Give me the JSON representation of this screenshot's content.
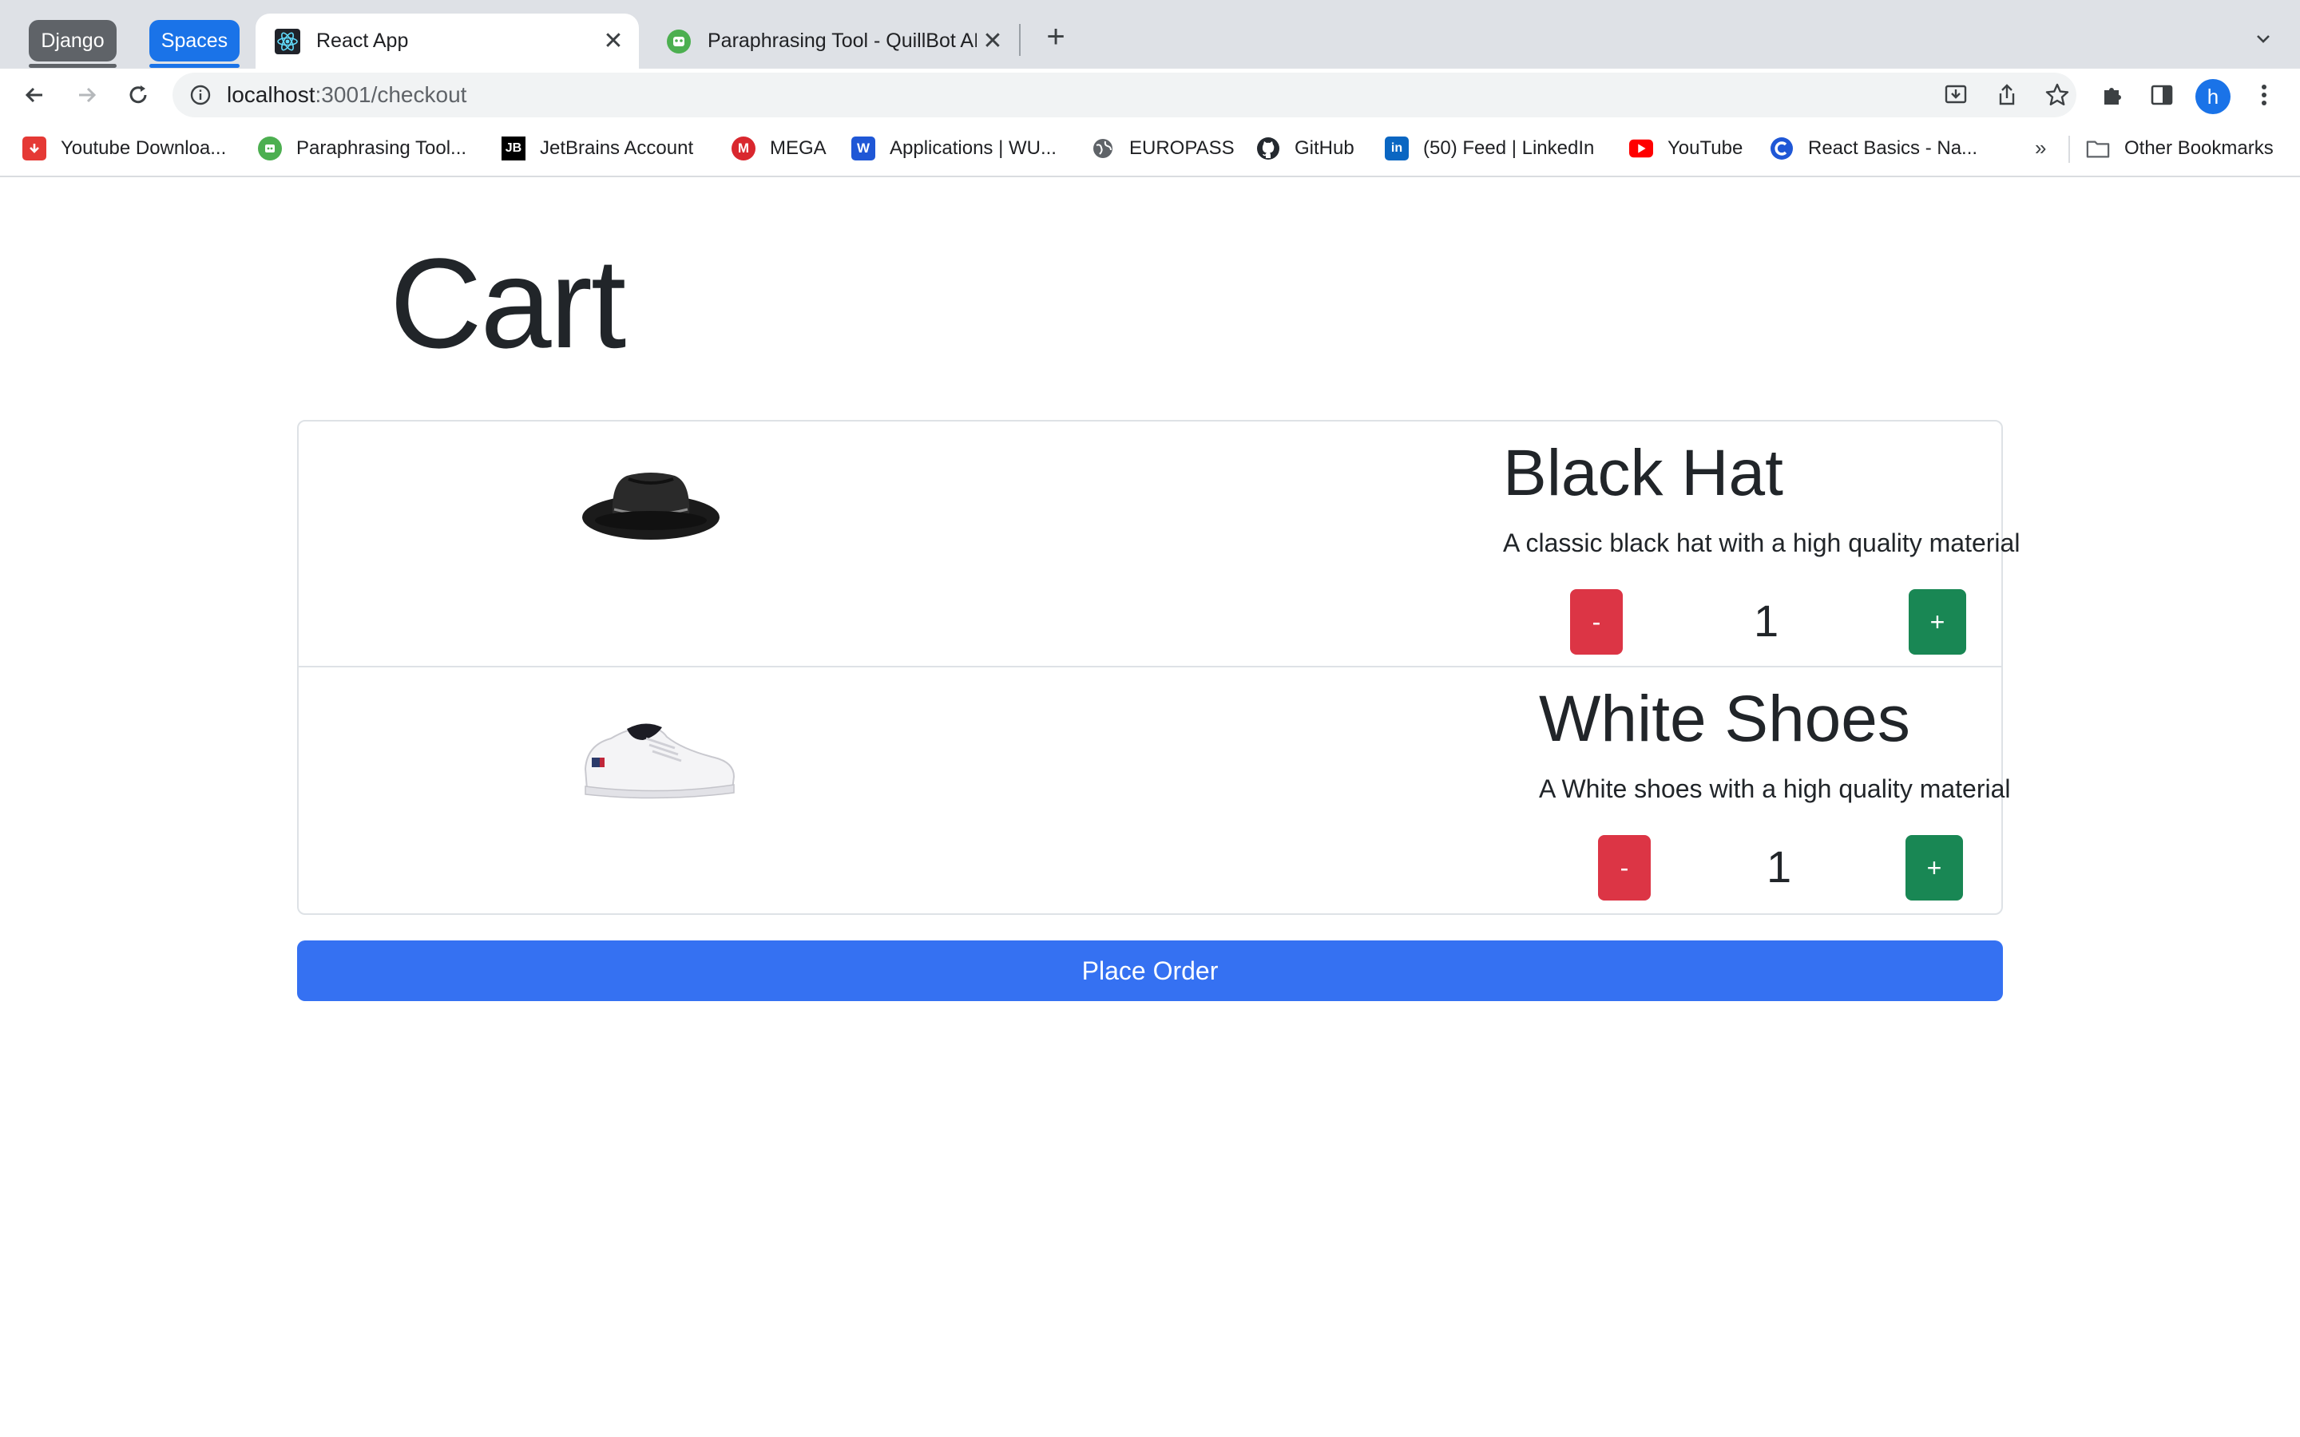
{
  "browser": {
    "tab_groups": [
      {
        "label": "Django",
        "color": "#5f6368"
      },
      {
        "label": "Spaces",
        "color": "#1a73e8"
      }
    ],
    "tabs": [
      {
        "title": "React App",
        "active": true,
        "icon": "react-icon"
      },
      {
        "title": "Paraphrasing Tool - QuillBot AI",
        "active": false,
        "icon": "quillbot-icon"
      }
    ],
    "address": {
      "host": "localhost",
      "path": ":3001/checkout"
    },
    "profile_initial": "h",
    "bookmarks": [
      {
        "label": "Youtube Downloa...",
        "icon": "youtube-downloader-icon",
        "color": "#e53935"
      },
      {
        "label": "Paraphrasing Tool...",
        "icon": "quillbot-icon",
        "color": "#4caf50"
      },
      {
        "label": "JetBrains Account",
        "icon": "jetbrains-icon",
        "color": "#000000"
      },
      {
        "label": "MEGA",
        "icon": "mega-icon",
        "color": "#d9272e"
      },
      {
        "label": "Applications | WU...",
        "icon": "wu-icon",
        "color": "#1f57d6"
      },
      {
        "label": "EUROPASS",
        "icon": "globe-icon",
        "color": "#5f6368"
      },
      {
        "label": "GitHub",
        "icon": "github-icon",
        "color": "#24292f"
      },
      {
        "label": "(50) Feed | LinkedIn",
        "icon": "linkedin-icon",
        "color": "#0a66c2"
      },
      {
        "label": "YouTube",
        "icon": "youtube-icon",
        "color": "#ff0000"
      },
      {
        "label": "React Basics - Na...",
        "icon": "coursera-icon",
        "color": "#1f57d6"
      }
    ],
    "bookmarks_overflow": "»",
    "other_bookmarks": "Other Bookmarks"
  },
  "page": {
    "title": "Cart",
    "items": [
      {
        "name": "Black Hat",
        "description": "A classic black hat with a high quality material",
        "quantity": "1",
        "image": "black-hat-image"
      },
      {
        "name": "White Shoes",
        "description": "A White shoes with a high quality material",
        "quantity": "1",
        "image": "white-shoes-image"
      }
    ],
    "decrement_label": "-",
    "increment_label": "+",
    "place_order_label": "Place Order",
    "colors": {
      "danger": "#dc3545",
      "success": "#198754",
      "primary": "#3571f2"
    }
  }
}
